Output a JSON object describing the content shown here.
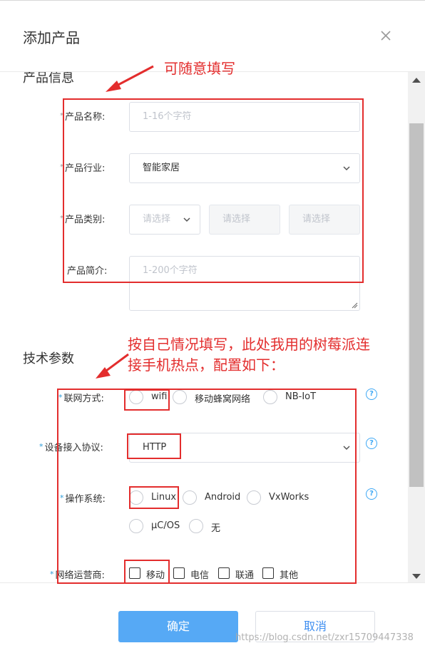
{
  "dialog": {
    "title": "添加产品"
  },
  "product_info": {
    "section_title": "产品信息",
    "name": {
      "label": "产品名称:",
      "placeholder": "1-16个字符"
    },
    "industry": {
      "label": "产品行业:",
      "value": "智能家居"
    },
    "category": {
      "label": "产品类别:",
      "select1": "请选择",
      "select2": "请选择",
      "select3": "请选择"
    },
    "intro": {
      "label": "产品简介:",
      "placeholder": "1-200个字符"
    }
  },
  "tech_params": {
    "section_title": "技术参数",
    "network": {
      "label": "联网方式:",
      "options": [
        "wifi",
        "移动蜂窝网络",
        "NB-IoT"
      ]
    },
    "protocol": {
      "label": "设备接入协议:",
      "value": "HTTP"
    },
    "os": {
      "label": "操作系统:",
      "options": [
        "Linux",
        "Android",
        "VxWorks",
        "μC/OS",
        "无"
      ]
    },
    "carrier": {
      "label": "网络运营商:",
      "options": [
        "移动",
        "电信",
        "联通",
        "其他"
      ]
    },
    "help_glyph": "?"
  },
  "annotations": {
    "top": "可随意填写",
    "middle_line1": "按自己情况填写，此处我用的树莓派连",
    "middle_line2": "接手机热点，配置如下："
  },
  "footer": {
    "confirm_label": "确定",
    "cancel_label": "取消"
  },
  "watermark": "https://blog.csdn.net/zxr15709447338",
  "colors": {
    "primary": "#56a9f5",
    "link": "#3e8ef0",
    "required_star": "#2d9bd8",
    "annotation_red": "#e32d2d",
    "help_blue": "#3da8f5"
  }
}
